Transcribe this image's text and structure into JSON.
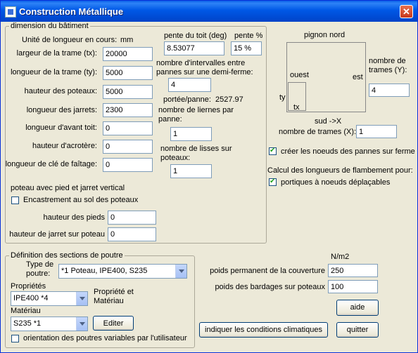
{
  "window": {
    "title": "Construction Métallique",
    "close_glyph": "✕"
  },
  "dim_group": {
    "legend": "dimension du bâtiment",
    "unit_label": "Unité de longueur en cours:",
    "unit_value": "mm",
    "fields": [
      {
        "label": "largeur de la trame (tx):",
        "value": "20000"
      },
      {
        "label": "longueur de la trame (ty):",
        "value": "5000"
      },
      {
        "label": "hauteur des poteaux:",
        "value": "5000"
      },
      {
        "label": "longueur des jarrets:",
        "value": "2300"
      },
      {
        "label": "longueur d'avant toit:",
        "value": "0"
      },
      {
        "label": "hauteur d'acrotère:",
        "value": "0"
      },
      {
        "label": "longueur de clé de faîtage:",
        "value": "0"
      }
    ],
    "pente_deg_label": "pente du toit (deg)",
    "pente_deg_value": "8.53077",
    "pente_pct_label": "pente %",
    "pente_pct_value": "15 %",
    "intervalles_label": "nombre d'intervalles entre pannes sur une demi-ferme:",
    "intervalles_value": "4",
    "portee_label": "portée/panne:",
    "portee_value": "2527.97",
    "liernes_label": "nombre de liernes par panne:",
    "liernes_value": "1",
    "lisses_label": "nombre de lisses sur poteaux:",
    "lisses_value": "1",
    "poteau_title": "poteau avec pied et jarret vertical",
    "encastrement_label": "Encastrement au sol des poteaux",
    "hauteur_pieds_label": "hauteur des pieds",
    "hauteur_pieds_value": "0",
    "hauteur_jarret_label": "hauteur de jarret sur poteau",
    "hauteur_jarret_value": "0"
  },
  "right_panel": {
    "pignon_label": "pignon nord",
    "ouest_label": "ouest",
    "est_label": "est",
    "ty_label": "ty",
    "tx_label": "tx",
    "sud_label": "sud ->X",
    "trames_y_label": "nombre de trames (Y):",
    "trames_y_value": "4",
    "trames_x_label": "nombre de trames (X):",
    "trames_x_value": "1",
    "noeuds_pannes_label": "créer les noeuds des pannes sur ferme",
    "noeuds_pannes_checked": true,
    "flambement_label": "Calcul des longueurs de flambement pour:",
    "portiques_label": "portiques à noeuds déplaçables",
    "portiques_checked": true
  },
  "sections_group": {
    "legend": "Définition des sections de poutre",
    "type_label": "Type de poutre:",
    "type_value": "*1 Poteau, IPE400, S235",
    "proprietes_label": "Propriétés",
    "proprietes_value": "IPE400 *4",
    "prop_mat_label": "Propriété et Matériau",
    "materiau_label": "Matériau",
    "materiau_value": "S235 *1",
    "editer_label": "Editer",
    "orientation_label": "orientation des poutres variables par l'utilisateur"
  },
  "loads": {
    "unit": "N/m2",
    "poids_couverture_label": "poids permanent de la couverture",
    "poids_couverture_value": "250",
    "poids_bardages_label": "poids des bardages sur poteaux",
    "poids_bardages_value": "100"
  },
  "buttons": {
    "aide": "aide",
    "climat": "indiquer les conditions climatiques",
    "quitter": "quitter"
  }
}
